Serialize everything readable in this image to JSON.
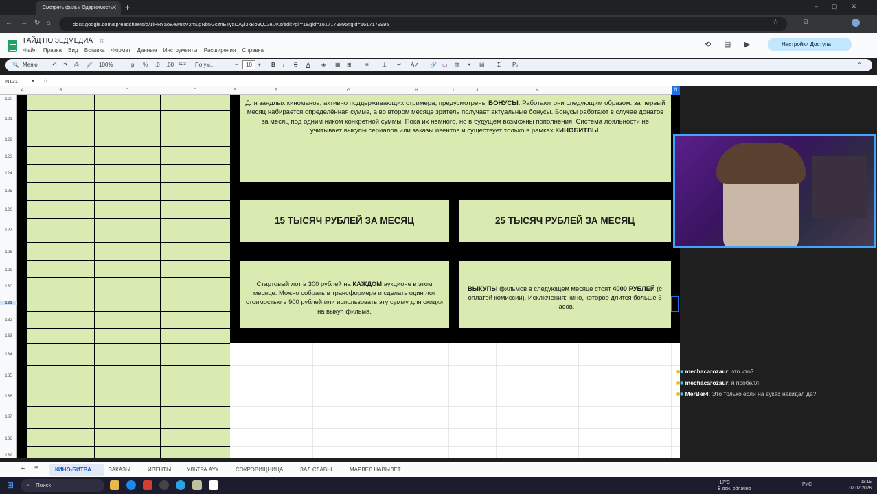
{
  "browser": {
    "tab_title": "Смотреть фильм Одержимость",
    "url": "docs.google.com/spreadsheets/d/1lPRYaoEew8sV2mLgNb5GcznETy5DAyl3kBb9QJ2eUKs/edit?pli=1&gid=1617179995#gid=1617179995"
  },
  "sheets": {
    "doc_title": "ГАЙД ПО ЗЕДМЕДИА",
    "menus": [
      "Файл",
      "Правка",
      "Вид",
      "Вставка",
      "Формат",
      "Данные",
      "Инструменты",
      "Расширения",
      "Справка"
    ],
    "share_label": "Настройки Доступа",
    "toolbar": {
      "menu_search": "Меню",
      "zoom": "100%",
      "currency": "р.",
      "percent": "%",
      "dec_dec": ".0",
      "dec_inc": ".00",
      "number_format": "123",
      "font": "По ум...",
      "font_size": "10"
    },
    "name_box": "N131",
    "fx": "fx",
    "columns": [
      "A",
      "B",
      "C",
      "D",
      "E",
      "F",
      "G",
      "H",
      "I",
      "J",
      "K",
      "L"
    ],
    "rows": [
      "120",
      "121",
      "122",
      "123",
      "124",
      "125",
      "126",
      "127",
      "128",
      "129",
      "130",
      "131",
      "132",
      "133",
      "134",
      "135",
      "136",
      "137",
      "138",
      "139"
    ],
    "sheet_tabs": [
      "КИНО-БИТВА",
      "ЗАКАЗЫ",
      "ИВЕНТЫ",
      "УЛЬТРА АУК",
      "СОКРОВИЩНИЦА",
      "ЗАЛ СЛАВЫ",
      "МАРВЕЛ НАВЫЛЕТ"
    ],
    "active_tab": "КИНО-БИТВА"
  },
  "content": {
    "intro": {
      "t1": "Для заядлых киноманов, активно поддерживающих стримера, предусмотрены ",
      "b1": "БОНУСЫ",
      "t2": ". Работают они следующим образом: за первый месяц набирается определённая сумма, а во втором месяце зритель получает актуальные бонусы. Бонусы работают в случае донатов за месяц под одним ником конкретной суммы. Пока их немного, но в будущем возможны пополнения! Система лояльности не учитывает выкупы сериалов или заказы ивентов и существует только в рамках ",
      "b2": "КИНОБИТВЫ",
      "t3": "."
    },
    "tier1_heading": "15 ТЫСЯЧ РУБЛЕЙ ЗА МЕСЯЦ",
    "tier2_heading": "25 ТЫСЯЧ РУБЛЕЙ ЗА МЕСЯЦ",
    "tier1_text": {
      "t1": "Стартовый лот в 300 рублей на ",
      "b1": "КАЖДОМ",
      "t2": " аукционе в этом месяце. Можно собрать в трансформера и сделать один лот стоимостью в 900 рублей или использовать эту сумму для скидки на выкуп фильма."
    },
    "tier2_text": {
      "b1": "ВЫКУПЫ",
      "t1": " фильмов в следующем месяце стоят ",
      "b2": "4000 РУБЛЕЙ",
      "t2": " (с оплатой комиссии). Исключения: кино, которое длится больше 3 часов."
    }
  },
  "chat": [
    {
      "user": "mechacarozaur",
      "msg": "это что?"
    },
    {
      "user": "mechacarozaur",
      "msg": "я пробелл"
    },
    {
      "user": "MerBer4",
      "msg": "Это только если на ауках накидал да?"
    }
  ],
  "taskbar": {
    "search": "Поиск",
    "weather_temp": "-17°C",
    "weather_desc": "В осн. облачно",
    "lang": "РУС",
    "time": "23:15",
    "date": "02.02.2026"
  },
  "colors": {
    "panel_green": "#d9ebb0",
    "panel_black": "#000000",
    "webcam_border": "#3fa5ff",
    "share_bg": "#c2e7ff"
  }
}
